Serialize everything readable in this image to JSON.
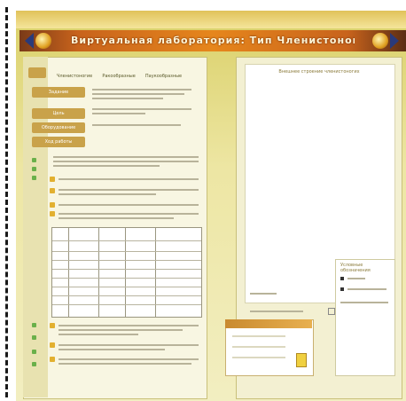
{
  "banner": {
    "title": "Виртуальная лаборатория: Тип Членистоногие"
  },
  "nav": {
    "items": [
      "Членистоногие",
      "Ракообразные",
      "Паукообразные"
    ]
  },
  "sidebar": {
    "tabs": [
      "Задание",
      "Цель",
      "Оборудование",
      "Ход работы"
    ]
  },
  "right": {
    "heading": "Внешнее строение членистоногих",
    "side_title": "Условные обозначения"
  },
  "colors": {
    "accent": "#c9a24a",
    "banner": "#e6861c",
    "frame": "#ede6a3"
  }
}
